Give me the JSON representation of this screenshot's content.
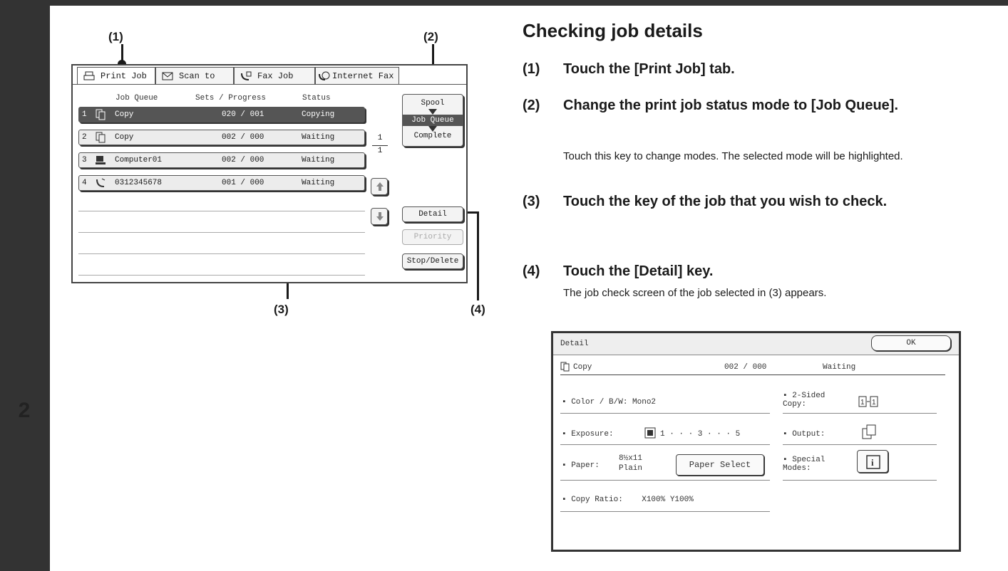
{
  "step_number": "2",
  "callouts": {
    "c1": "(1)",
    "c2": "(2)",
    "c3": "(3)",
    "c4": "(4)"
  },
  "panel": {
    "tabs": [
      {
        "label": "Print Job",
        "icon": "printer-icon"
      },
      {
        "label": "Scan to",
        "icon": "scan-icon"
      },
      {
        "label": "Fax Job",
        "icon": "fax-icon"
      },
      {
        "label": "Internet Fax",
        "icon": "internet-fax-icon"
      }
    ],
    "columns": {
      "job_queue": "Job Queue",
      "sets_progress": "Sets / Progress",
      "status": "Status"
    },
    "rows": [
      {
        "num": "1",
        "icon": "copy-icon",
        "name": "Copy",
        "progress": "020 / 001",
        "status": "Copying"
      },
      {
        "num": "2",
        "icon": "copy-icon",
        "name": "Copy",
        "progress": "002 / 000",
        "status": "Waiting"
      },
      {
        "num": "3",
        "icon": "computer-icon",
        "name": "Computer01",
        "progress": "002 / 000",
        "status": "Waiting"
      },
      {
        "num": "4",
        "icon": "phone-icon",
        "name": "0312345678",
        "progress": "001 / 000",
        "status": "Waiting"
      }
    ],
    "page": {
      "current": "1",
      "total": "1"
    },
    "modes": {
      "spool": "Spool",
      "job_queue": "Job Queue",
      "complete": "Complete"
    },
    "buttons": {
      "detail": "Detail",
      "priority": "Priority",
      "stop_delete": "Stop/Delete"
    }
  },
  "right": {
    "heading": "Checking job details",
    "steps": [
      {
        "num": "(1)",
        "text": "Touch the [Print Job] tab."
      },
      {
        "num": "(2)",
        "text": "Change the print job status mode to [Job Queue]."
      },
      {
        "num": "(3)",
        "text": "Touch the key of the job that you wish to check."
      },
      {
        "num": "(4)",
        "text": "Touch the [Detail] key."
      }
    ],
    "desc2": "Touch this key to change modes. The selected mode will be highlighted.",
    "desc4": "The job check screen of the job selected in (3) appears."
  },
  "detail_screen": {
    "title": "Detail",
    "ok": "OK",
    "job_name": "Copy",
    "job_progress": "002 / 000",
    "job_status": "Waiting",
    "color_bw": "Color / B/W: Mono2",
    "two_sided_label": "2-Sided Copy:",
    "exposure_label": "Exposure:",
    "exposure_scale": "1 · · · 3 · · · 5",
    "output_label": "Output:",
    "paper_label": "Paper:",
    "paper_size": "8½x11",
    "paper_type": "Plain",
    "paper_select": "Paper Select",
    "special_label": "Special Modes:",
    "copy_ratio": "Copy Ratio:    X100% Y100%"
  }
}
